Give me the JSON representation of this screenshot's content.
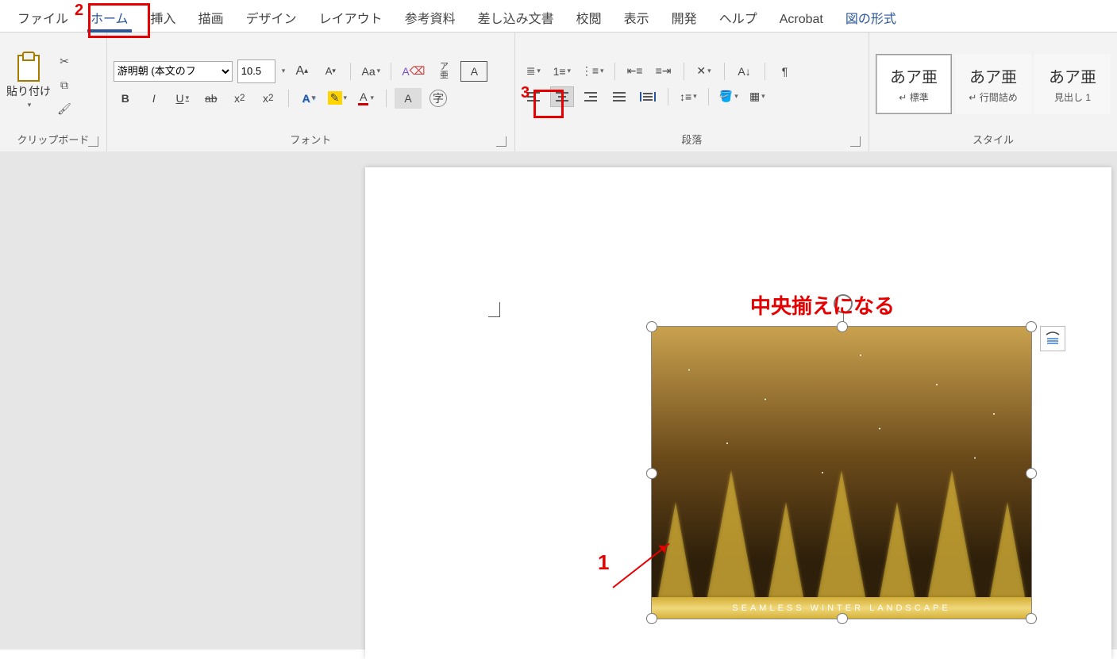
{
  "tabs": {
    "file": "ファイル",
    "home": "ホーム",
    "insert": "挿入",
    "draw": "描画",
    "design": "デザイン",
    "layout": "レイアウト",
    "references": "参考資料",
    "mailings": "差し込み文書",
    "review": "校閲",
    "view": "表示",
    "developer": "開発",
    "help": "ヘルプ",
    "acrobat": "Acrobat",
    "picture_format": "図の形式"
  },
  "clipboard": {
    "paste": "貼り付け",
    "group": "クリップボード"
  },
  "font": {
    "name_value": "游明朝 (本文のフ",
    "size_value": "10.5",
    "group": "フォント"
  },
  "paragraph": {
    "group": "段落"
  },
  "styles": {
    "group": "スタイル",
    "sample": "あア亜",
    "items": [
      {
        "name": "標準",
        "prefix": "↵ "
      },
      {
        "name": "行間詰め",
        "prefix": "↵ "
      },
      {
        "name": "見出し 1",
        "prefix": ""
      }
    ]
  },
  "image_caption": "SEAMLESS WINTER LANDSCAPE",
  "annotations": {
    "n1": "1",
    "n2": "2",
    "n3": "3",
    "center_text": "中央揃えになる"
  }
}
